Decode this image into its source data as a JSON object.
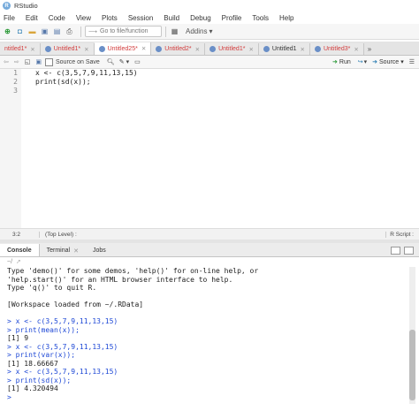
{
  "window": {
    "title": "RStudio",
    "app_icon": "R"
  },
  "menu": [
    "File",
    "Edit",
    "Code",
    "View",
    "Plots",
    "Session",
    "Build",
    "Debug",
    "Profile",
    "Tools",
    "Help"
  ],
  "toolbar": {
    "goto_placeholder": "Go to file/function",
    "addins_label": "Addins"
  },
  "editor_tabs": [
    {
      "label": "ntitled1*",
      "unsaved": true
    },
    {
      "label": "Untitled1*",
      "unsaved": true
    },
    {
      "label": "Untitled25*",
      "unsaved": true,
      "active": true
    },
    {
      "label": "Untitled2*",
      "unsaved": true
    },
    {
      "label": "Untitled1*",
      "unsaved": true
    },
    {
      "label": "Untitled1",
      "unsaved": false
    },
    {
      "label": "Untitled3*",
      "unsaved": true
    }
  ],
  "editor_toolbar": {
    "source_on_save_label": "Source on Save",
    "run_label": "Run",
    "source_label": "Source"
  },
  "code_lines": [
    "x <- c(3,5,7,9,11,13,15)",
    "print(sd(x));",
    ""
  ],
  "line_numbers": [
    "1",
    "2",
    "3"
  ],
  "status": {
    "position": "3:2",
    "level": "(Top Level) :",
    "file_type": "R Script :"
  },
  "console_tabs": [
    {
      "label": "Console",
      "active": true
    },
    {
      "label": "Terminal"
    },
    {
      "label": "Jobs"
    }
  ],
  "console_path": "~/",
  "console_lines": [
    {
      "text": "Type 'demo()' for some demos, 'help()' for on-line help, or",
      "kind": "out"
    },
    {
      "text": "'help.start()' for an HTML browser interface to help.",
      "kind": "out"
    },
    {
      "text": "Type 'q()' to quit R.",
      "kind": "out"
    },
    {
      "text": "",
      "kind": "out"
    },
    {
      "text": "[Workspace loaded from ~/.RData]",
      "kind": "out"
    },
    {
      "text": "",
      "kind": "out"
    },
    {
      "text": "> x <- c(3,5,7,9,11,13,15)",
      "kind": "prompt"
    },
    {
      "text": "> print(mean(x));",
      "kind": "prompt"
    },
    {
      "text": "[1] 9",
      "kind": "out"
    },
    {
      "text": "> x <- c(3,5,7,9,11,13,15)",
      "kind": "prompt"
    },
    {
      "text": "> print(var(x));",
      "kind": "prompt"
    },
    {
      "text": "[1] 18.66667",
      "kind": "out"
    },
    {
      "text": "> x <- c(3,5,7,9,11,13,15)",
      "kind": "prompt"
    },
    {
      "text": "> print(sd(x));",
      "kind": "prompt"
    },
    {
      "text": "[1] 4.320494",
      "kind": "out"
    },
    {
      "text": ">",
      "kind": "prompt"
    }
  ],
  "colors": {
    "prompt": "#1e48d6",
    "unsaved_tab": "#d23b3b",
    "accent": "#75aadb"
  }
}
